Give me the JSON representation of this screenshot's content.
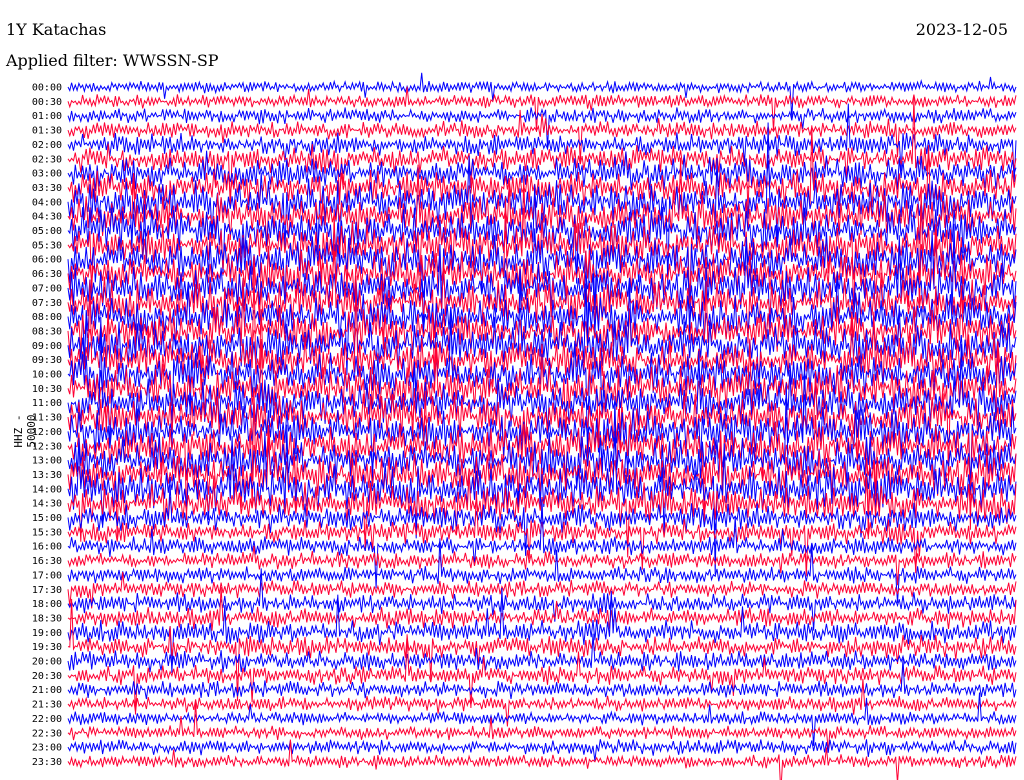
{
  "header": {
    "title": "1Y Katachas",
    "filter": "Applied filter: WWSSN-SP",
    "date": "2023-12-05"
  },
  "chart_data": {
    "type": "line",
    "title": "1Y Katachas",
    "subtitle": "Applied filter: WWSSN-SP",
    "ylabel": "HHZ - 50000",
    "xlabel": "",
    "rows": [
      "00:00",
      "00:30",
      "01:00",
      "01:30",
      "02:00",
      "02:30",
      "03:00",
      "03:30",
      "04:00",
      "04:30",
      "05:00",
      "05:30",
      "06:00",
      "06:30",
      "07:00",
      "07:30",
      "08:00",
      "08:30",
      "09:00",
      "09:30",
      "10:00",
      "10:30",
      "11:00",
      "11:30",
      "12:00",
      "12:30",
      "13:00",
      "13:30",
      "14:00",
      "14:30",
      "15:00",
      "15:30",
      "16:00",
      "16:30",
      "17:00",
      "17:30",
      "18:00",
      "18:30",
      "19:00",
      "19:30",
      "20:00",
      "20:30",
      "21:00",
      "21:30",
      "22:00",
      "22:30",
      "23:00",
      "23:30"
    ],
    "series_colors": [
      "#0000ff",
      "#ff0033"
    ],
    "activity": [
      0.15,
      0.2,
      0.25,
      0.3,
      0.45,
      0.55,
      0.7,
      0.8,
      0.9,
      1.0,
      1.0,
      1.0,
      1.0,
      1.0,
      1.0,
      1.0,
      1.0,
      1.0,
      1.0,
      1.0,
      1.0,
      1.0,
      1.0,
      1.0,
      1.0,
      1.0,
      1.0,
      1.0,
      1.0,
      0.9,
      0.6,
      0.45,
      0.35,
      0.3,
      0.3,
      0.3,
      0.4,
      0.4,
      0.45,
      0.45,
      0.4,
      0.35,
      0.3,
      0.25,
      0.2,
      0.2,
      0.25,
      0.2
    ]
  }
}
